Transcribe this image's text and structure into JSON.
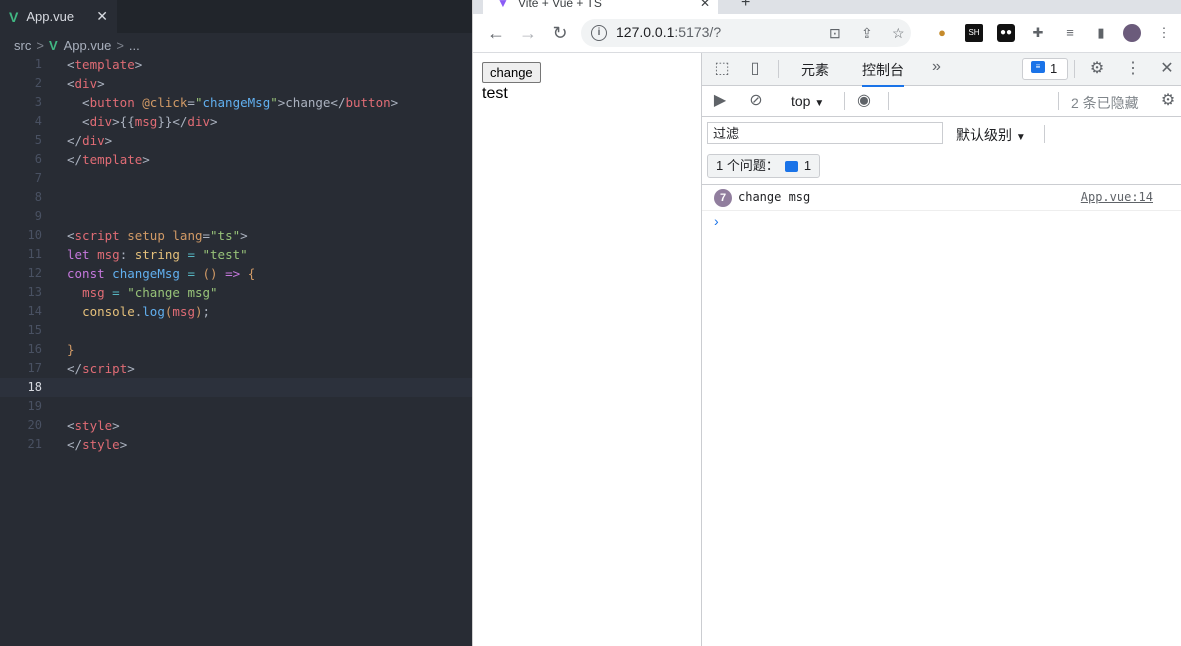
{
  "editor": {
    "tab": {
      "logo": "V",
      "label": "App.vue",
      "close": "✕"
    },
    "breadcrumb": {
      "folder": "src",
      "sep1": ">",
      "logo": "V",
      "file": "App.vue",
      "sep2": ">",
      "more": "..."
    },
    "current_line": "18",
    "lines": [
      {
        "n": "1",
        "tokens": [
          {
            "c": "pun",
            "t": "<"
          },
          {
            "c": "tag",
            "t": "template"
          },
          {
            "c": "pun",
            "t": ">"
          }
        ]
      },
      {
        "n": "2",
        "tokens": [
          {
            "c": "pun",
            "t": "<"
          },
          {
            "c": "tag",
            "t": "div"
          },
          {
            "c": "pun",
            "t": ">"
          }
        ]
      },
      {
        "n": "3",
        "tokens": [
          {
            "c": "pun",
            "t": "  <"
          },
          {
            "c": "tag",
            "t": "button"
          },
          {
            "c": "plain",
            "t": " "
          },
          {
            "c": "attr",
            "t": "@click"
          },
          {
            "c": "pun",
            "t": "="
          },
          {
            "c": "str",
            "t": "\""
          },
          {
            "c": "fn",
            "t": "changeMsg"
          },
          {
            "c": "str",
            "t": "\""
          },
          {
            "c": "pun",
            "t": ">change</"
          },
          {
            "c": "tag",
            "t": "button"
          },
          {
            "c": "pun",
            "t": ">"
          }
        ]
      },
      {
        "n": "4",
        "tokens": [
          {
            "c": "pun",
            "t": "  <"
          },
          {
            "c": "tag",
            "t": "div"
          },
          {
            "c": "pun",
            "t": ">{{"
          },
          {
            "c": "var",
            "t": "msg"
          },
          {
            "c": "pun",
            "t": "}}</"
          },
          {
            "c": "tag",
            "t": "div"
          },
          {
            "c": "pun",
            "t": ">"
          }
        ]
      },
      {
        "n": "5",
        "tokens": [
          {
            "c": "pun",
            "t": "</"
          },
          {
            "c": "tag",
            "t": "div"
          },
          {
            "c": "pun",
            "t": ">"
          }
        ]
      },
      {
        "n": "6",
        "tokens": [
          {
            "c": "pun",
            "t": "</"
          },
          {
            "c": "tag",
            "t": "template"
          },
          {
            "c": "pun",
            "t": ">"
          }
        ]
      },
      {
        "n": "7",
        "tokens": []
      },
      {
        "n": "8",
        "tokens": []
      },
      {
        "n": "9",
        "tokens": []
      },
      {
        "n": "10",
        "tokens": [
          {
            "c": "pun",
            "t": "<"
          },
          {
            "c": "tag",
            "t": "script"
          },
          {
            "c": "plain",
            "t": " "
          },
          {
            "c": "attr",
            "t": "setup"
          },
          {
            "c": "plain",
            "t": " "
          },
          {
            "c": "attr",
            "t": "lang"
          },
          {
            "c": "pun",
            "t": "="
          },
          {
            "c": "str",
            "t": "\"ts\""
          },
          {
            "c": "pun",
            "t": ">"
          }
        ]
      },
      {
        "n": "11",
        "tokens": [
          {
            "c": "kw",
            "t": "let"
          },
          {
            "c": "plain",
            "t": " "
          },
          {
            "c": "var",
            "t": "msg"
          },
          {
            "c": "pun",
            "t": ": "
          },
          {
            "c": "typ",
            "t": "string"
          },
          {
            "c": "plain",
            "t": " "
          },
          {
            "c": "op",
            "t": "="
          },
          {
            "c": "plain",
            "t": " "
          },
          {
            "c": "str",
            "t": "\"test\""
          }
        ]
      },
      {
        "n": "12",
        "tokens": [
          {
            "c": "kw",
            "t": "const"
          },
          {
            "c": "plain",
            "t": " "
          },
          {
            "c": "fn",
            "t": "changeMsg"
          },
          {
            "c": "plain",
            "t": " "
          },
          {
            "c": "op",
            "t": "="
          },
          {
            "c": "plain",
            "t": " "
          },
          {
            "c": "attr",
            "t": "()"
          },
          {
            "c": "plain",
            "t": " "
          },
          {
            "c": "kw",
            "t": "=>"
          },
          {
            "c": "plain",
            "t": " "
          },
          {
            "c": "attr",
            "t": "{"
          }
        ]
      },
      {
        "n": "13",
        "tokens": [
          {
            "c": "plain",
            "t": "  "
          },
          {
            "c": "var",
            "t": "msg"
          },
          {
            "c": "plain",
            "t": " "
          },
          {
            "c": "op",
            "t": "="
          },
          {
            "c": "plain",
            "t": " "
          },
          {
            "c": "str",
            "t": "\"change msg\""
          }
        ]
      },
      {
        "n": "14",
        "tokens": [
          {
            "c": "plain",
            "t": "  "
          },
          {
            "c": "typ",
            "t": "console"
          },
          {
            "c": "pun",
            "t": "."
          },
          {
            "c": "fn",
            "t": "log"
          },
          {
            "c": "attr",
            "t": "("
          },
          {
            "c": "var",
            "t": "msg"
          },
          {
            "c": "attr",
            "t": ")"
          },
          {
            "c": "pun",
            "t": ";"
          }
        ]
      },
      {
        "n": "15",
        "tokens": []
      },
      {
        "n": "16",
        "tokens": [
          {
            "c": "attr",
            "t": "}"
          }
        ]
      },
      {
        "n": "17",
        "tokens": [
          {
            "c": "pun",
            "t": "</"
          },
          {
            "c": "tag",
            "t": "script"
          },
          {
            "c": "pun",
            "t": ">"
          }
        ]
      },
      {
        "n": "18",
        "tokens": []
      },
      {
        "n": "19",
        "tokens": []
      },
      {
        "n": "20",
        "tokens": [
          {
            "c": "pun",
            "t": "<"
          },
          {
            "c": "tag",
            "t": "style"
          },
          {
            "c": "pun",
            "t": ">"
          }
        ]
      },
      {
        "n": "21",
        "tokens": [
          {
            "c": "pun",
            "t": "</"
          },
          {
            "c": "tag",
            "t": "style"
          },
          {
            "c": "pun",
            "t": ">"
          }
        ]
      }
    ]
  },
  "browser": {
    "tab_title": "Vite + Vue + TS",
    "tab_close": "✕",
    "new_tab": "+",
    "url_host": "127.0.0.1",
    "url_rest": ":5173/?",
    "page": {
      "button_label": "change",
      "text": "test"
    }
  },
  "devtools": {
    "tabs": [
      "元素",
      "控制台"
    ],
    "more": "»",
    "issues_badge_count": "1",
    "context": "top",
    "hidden_count": "2 条已隐藏",
    "filter_placeholder": "过滤",
    "level": "默认级别",
    "issues_label": "1 个问题：",
    "issues_count": "1",
    "log": {
      "count": "7",
      "message": "change msg",
      "source": "App.vue:14"
    },
    "prompt": "›"
  },
  "colors": {
    "vue_green": "#41b883",
    "accent": "#1a73e8",
    "editor_bg": "#282c34"
  }
}
